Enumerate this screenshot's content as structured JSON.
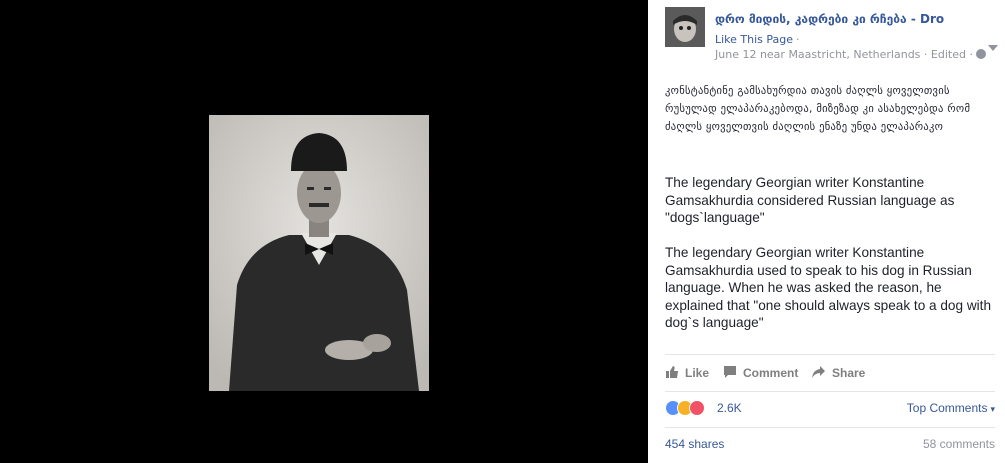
{
  "photo": {
    "alt": ""
  },
  "post": {
    "page_name": "დრო მიდის, კადრები კი რჩება - Dro",
    "like_page": "Like This Page",
    "like_page_sep": "·",
    "meta": "June 12 near Maastricht, Netherlands · Edited ·",
    "text_georgian": "კონსტანტინე გამსახურდია თავის ძაღლს ყოველთვის რუსულად ელაპარაკებოდა, მიზეზად კი ასახელებდა რომ ძაღლს ყოველთვის ძაღლის ენაზე უნდა ელაპარაკო",
    "text_en_1": "The legendary Georgian writer Konstantine Gamsakhurdia considered Russian language as \"dogs`language\"",
    "text_en_2": "The legendary Georgian writer Konstantine Gamsakhurdia used to speak to his dog in Russian language. When he was asked the reason, he explained that \"one should always speak to a dog with dog`s language\""
  },
  "actions": {
    "like": "Like",
    "comment": "Comment",
    "share": "Share"
  },
  "reactions": {
    "count": "2.6K",
    "icons": [
      "like-reaction-icon",
      "haha-reaction-icon",
      "love-reaction-icon"
    ],
    "colors": {
      "like": "#5890ff",
      "haha": "#f7b125",
      "love": "#f25268"
    }
  },
  "top_comments": "Top Comments",
  "shares": "454 shares",
  "comments": "58 comments"
}
